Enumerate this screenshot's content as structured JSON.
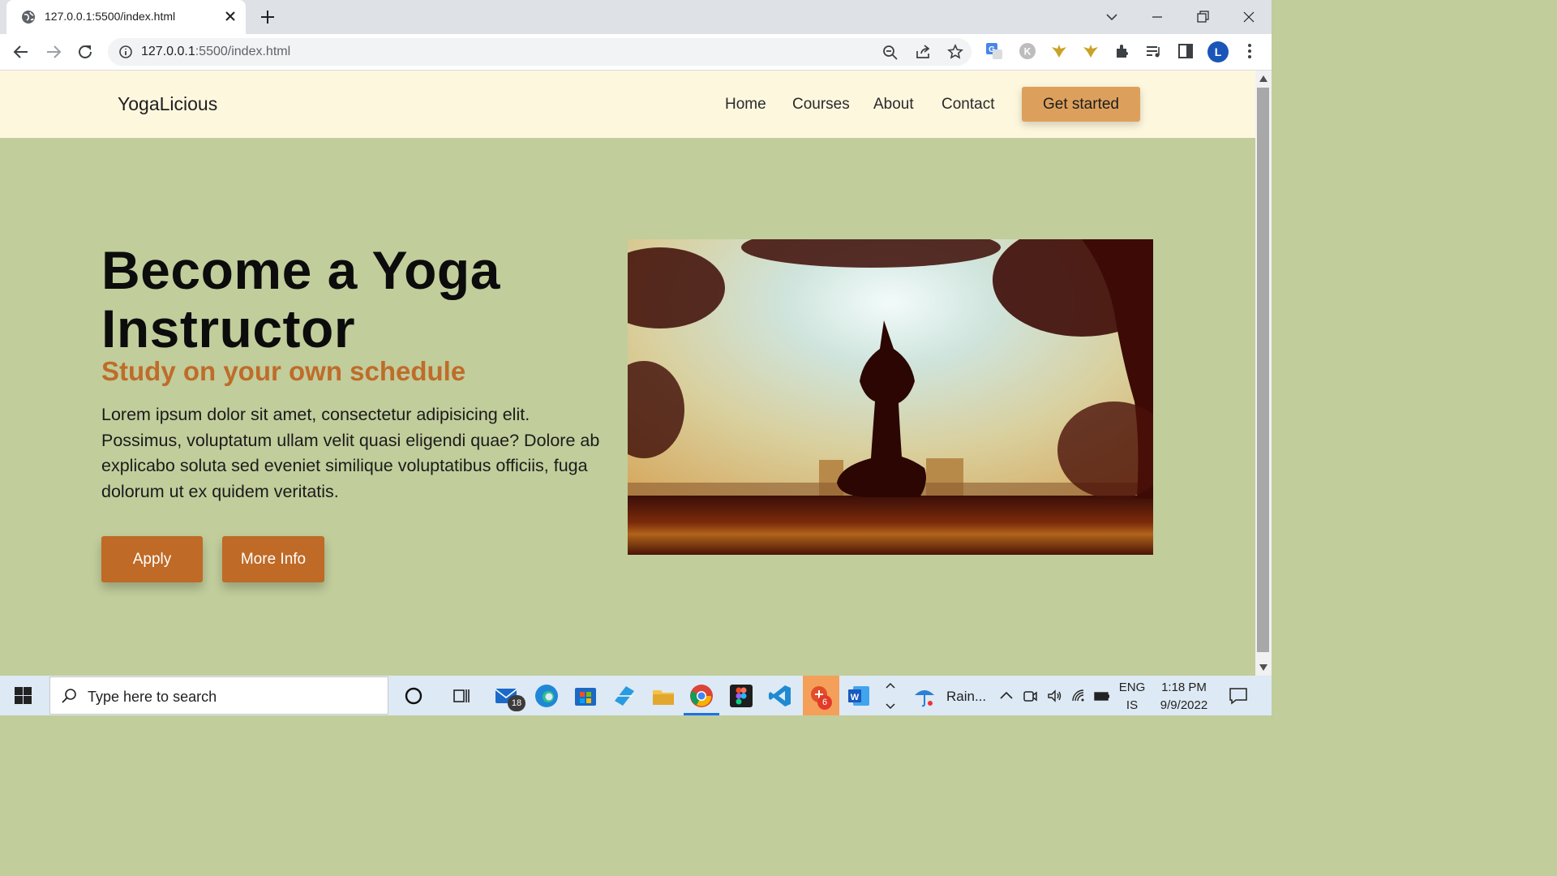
{
  "browser": {
    "tab_title": "127.0.0.1:5500/index.html",
    "url_host": "127.0.0.1",
    "url_rest": ":5500/index.html",
    "profile_initial": "L"
  },
  "page": {
    "brand": "YogaLicious",
    "nav": [
      "Home",
      "Courses",
      "About",
      "Contact"
    ],
    "cta_label": "Get started",
    "hero": {
      "title": "Become a Yoga Instructor",
      "subtitle": "Study on your own schedule",
      "body": "Lorem ipsum dolor sit amet, consectetur adipisicing elit. Possimus, voluptatum ullam velit quasi eligendi quae? Dolore ab explicabo soluta sed eveniet similique voluptatibus officiis, fuga dolorum ut ex quidem veritatis.",
      "apply_label": "Apply",
      "more_label": "More Info"
    },
    "colors": {
      "nav_bg": "#fdf7de",
      "hero_bg": "#c1cd9b",
      "cta": "#dda05c",
      "button": "#bf6a26",
      "subtitle": "#bf6c2a"
    }
  },
  "taskbar": {
    "search_placeholder": "Type here to search",
    "mail_badge": "18",
    "app_badge": "6",
    "weather": "Rain...",
    "lang_top": "ENG",
    "lang_bottom": "IS",
    "time": "1:18 PM",
    "date": "9/9/2022"
  }
}
